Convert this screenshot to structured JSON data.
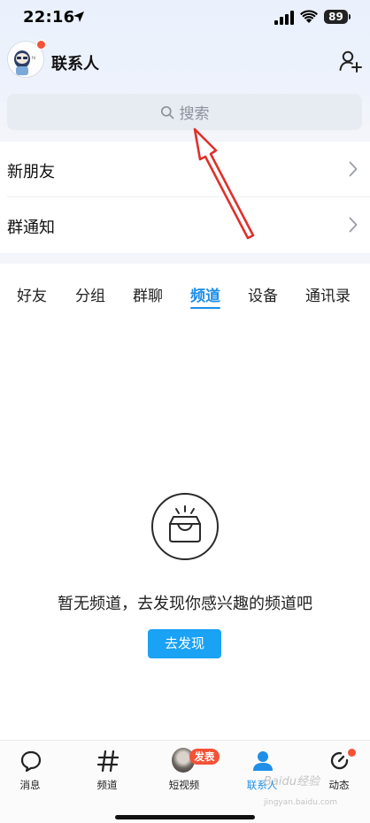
{
  "status_bar": {
    "time": "22:16",
    "battery": "89"
  },
  "header": {
    "title": "联系人",
    "avatar_icon": "avatar-image",
    "add_friend_icon": "add-user-icon"
  },
  "search": {
    "placeholder": "搜索"
  },
  "list": [
    {
      "label": "新朋友"
    },
    {
      "label": "群通知"
    }
  ],
  "tabs": [
    {
      "label": "好友"
    },
    {
      "label": "分组"
    },
    {
      "label": "群聊"
    },
    {
      "label": "频道",
      "active": true
    },
    {
      "label": "设备"
    },
    {
      "label": "通讯录"
    }
  ],
  "empty_state": {
    "icon": "inbox-icon",
    "message": "暂无频道，去发现你感兴趣的频道吧",
    "button_label": "去发现"
  },
  "bottom_nav": [
    {
      "label": "消息",
      "icon": "message-icon"
    },
    {
      "label": "频道",
      "icon": "hash-icon"
    },
    {
      "label": "短视频",
      "icon": "video-icon",
      "badge": "发表"
    },
    {
      "label": "联系人",
      "icon": "contacts-icon",
      "active": true
    },
    {
      "label": "动态",
      "icon": "refresh-icon"
    }
  ],
  "watermark": {
    "text": "Baidu经验",
    "sub": "jingyan.baidu.com"
  },
  "colors": {
    "accent": "#1e8ee8",
    "button": "#1aa2f5",
    "badge": "#f45236"
  }
}
